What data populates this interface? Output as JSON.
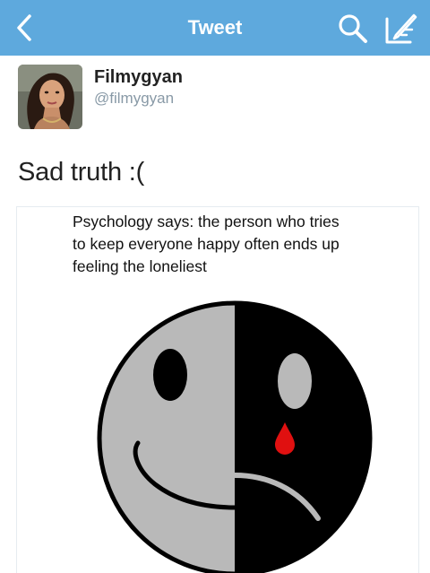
{
  "nav": {
    "title": "Tweet",
    "bar_color": "#5ea9dd",
    "back_icon": "chevron-left-icon",
    "search_icon": "search-icon",
    "compose_icon": "compose-icon"
  },
  "tweet": {
    "display_name": "Filmygyan",
    "username": "@filmygyan",
    "text": "Sad truth :(",
    "media": {
      "caption_lines": [
        "Psychology says: the person who tries",
        "to keep everyone happy often ends up",
        "feeling the loneliest"
      ],
      "image": "half-smiling-half-crying-face"
    }
  }
}
